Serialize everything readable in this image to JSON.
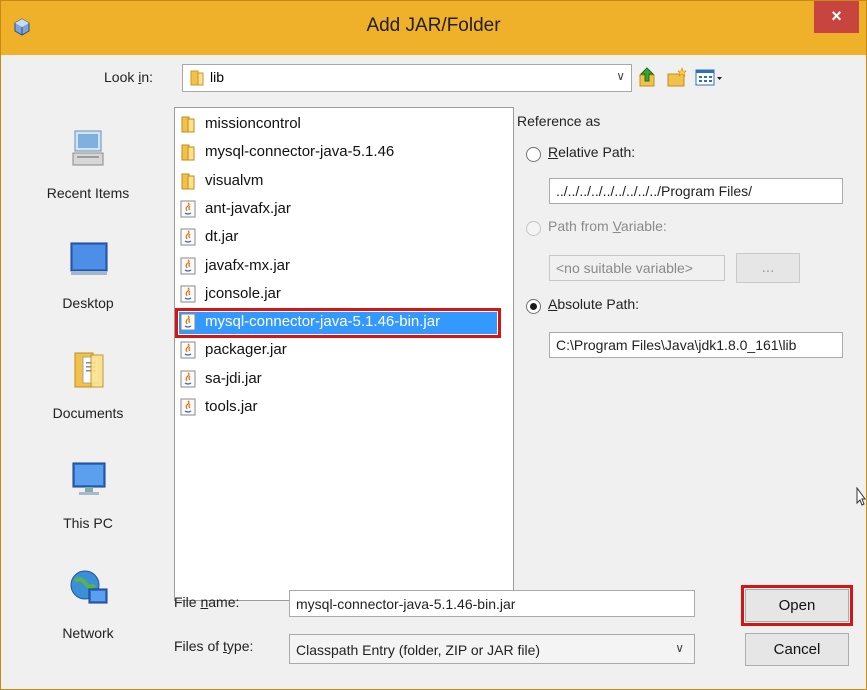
{
  "window": {
    "title": "Add JAR/Folder",
    "close_glyph": "×"
  },
  "lookin": {
    "label_pre": "Look ",
    "label_key": "i",
    "label_post": "n:",
    "value": "lib"
  },
  "toolbar": {
    "up_icon": "up-folder-icon",
    "new_icon": "new-folder-icon",
    "view_icon": "view-menu-icon"
  },
  "places": [
    {
      "label": "Recent Items",
      "icon": "recent-items-icon"
    },
    {
      "label": "Desktop",
      "icon": "desktop-icon"
    },
    {
      "label": "Documents",
      "icon": "documents-icon"
    },
    {
      "label": "This PC",
      "icon": "this-pc-icon"
    },
    {
      "label": "Network",
      "icon": "network-icon"
    }
  ],
  "files": [
    {
      "name": "missioncontrol",
      "type": "folder"
    },
    {
      "name": "mysql-connector-java-5.1.46",
      "type": "folder"
    },
    {
      "name": "visualvm",
      "type": "folder"
    },
    {
      "name": "ant-javafx.jar",
      "type": "jar"
    },
    {
      "name": "dt.jar",
      "type": "jar"
    },
    {
      "name": "javafx-mx.jar",
      "type": "jar"
    },
    {
      "name": "jconsole.jar",
      "type": "jar"
    },
    {
      "name": "mysql-connector-java-5.1.46-bin.jar",
      "type": "jar",
      "selected": true
    },
    {
      "name": "packager.jar",
      "type": "jar"
    },
    {
      "name": "sa-jdi.jar",
      "type": "jar"
    },
    {
      "name": "tools.jar",
      "type": "jar"
    }
  ],
  "reference": {
    "heading": "Reference as",
    "relative": {
      "key": "R",
      "rest": "elative Path:",
      "value": "../../../../../../../../../Program Files/"
    },
    "variable": {
      "pre": "Path from ",
      "key": "V",
      "rest": "ariable:",
      "value": "<no suitable variable>",
      "browse": "..."
    },
    "absolute": {
      "key": "A",
      "rest": "bsolute Path:",
      "value": "C:\\Program Files\\Java\\jdk1.8.0_161\\lib"
    },
    "selected": "absolute"
  },
  "filename": {
    "pre": "File ",
    "key": "n",
    "post": "ame:",
    "value": "mysql-connector-java-5.1.46-bin.jar"
  },
  "filetype": {
    "pre": "Files of ",
    "key": "t",
    "post": "ype:",
    "value": "Classpath Entry (folder, ZIP or JAR file)"
  },
  "buttons": {
    "open": "Open",
    "cancel": "Cancel"
  },
  "colors": {
    "title_bar": "#efb02a",
    "selection": "#3399ff",
    "highlight_box": "#d41515"
  }
}
